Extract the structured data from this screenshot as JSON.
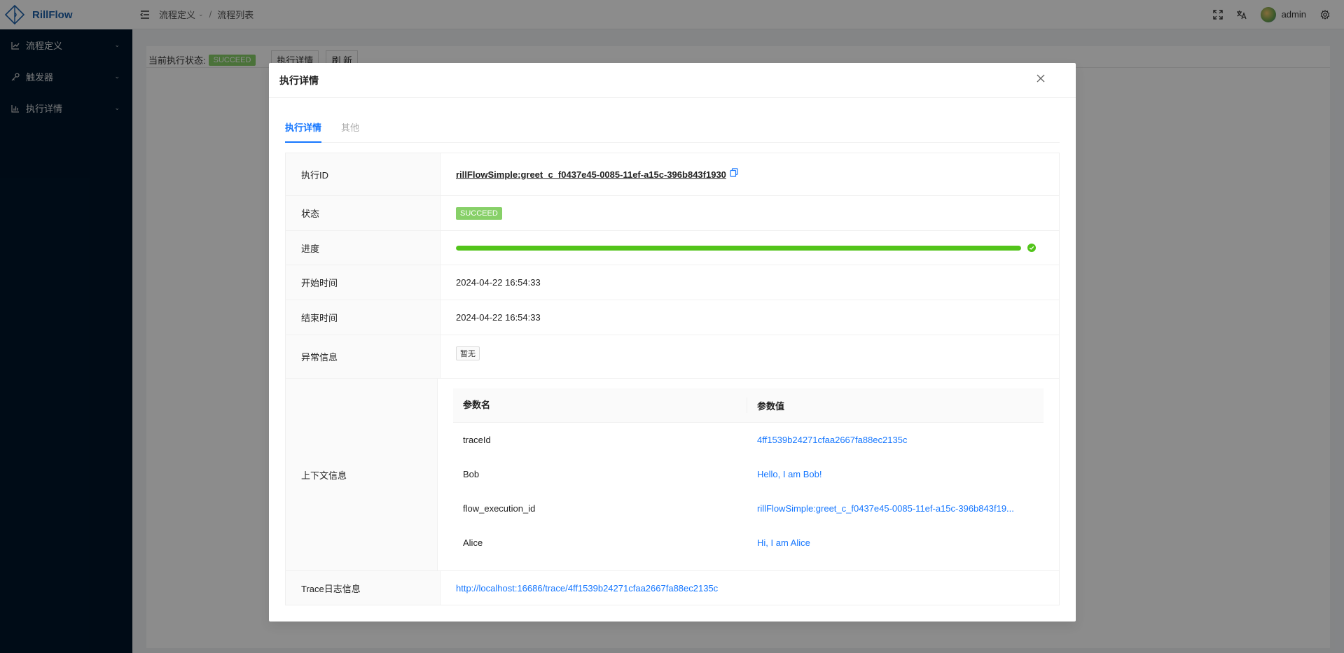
{
  "app": {
    "name": "RillFlow"
  },
  "sidebar": {
    "items": [
      {
        "label": "流程定义",
        "icon": "chart-icon"
      },
      {
        "label": "触发器",
        "icon": "key-icon"
      },
      {
        "label": "执行详情",
        "icon": "bar-chart-icon"
      }
    ]
  },
  "header": {
    "breadcrumb": [
      "流程定义",
      "流程列表"
    ],
    "user": "admin"
  },
  "page": {
    "status_label": "当前执行状态:",
    "status_value": "SUCCEED",
    "detail_button": "执行详情",
    "refresh_button": "刷 新"
  },
  "modal": {
    "title": "执行详情",
    "tabs": [
      {
        "label": "执行详情",
        "active": true
      },
      {
        "label": "其他",
        "active": false
      }
    ],
    "rows": {
      "exec_id_label": "执行ID",
      "exec_id": "rillFlowSimple:greet_c_f0437e45-0085-11ef-a15c-396b843f1930",
      "status_label": "状态",
      "status": "SUCCEED",
      "progress_label": "进度",
      "progress": 1.0,
      "start_label": "开始时间",
      "start_time": "2024-04-22 16:54:33",
      "end_label": "结束时间",
      "end_time": "2024-04-22 16:54:33",
      "error_label": "异常信息",
      "error": "暂无",
      "context_label": "上下文信息",
      "trace_label": "Trace日志信息",
      "trace_url": "http://localhost:16686/trace/4ff1539b24271cfaa2667fa88ec2135c"
    },
    "context": {
      "headers": [
        "参数名",
        "参数值"
      ],
      "rows": [
        {
          "name": "traceId",
          "value": "4ff1539b24271cfaa2667fa88ec2135c"
        },
        {
          "name": "Bob",
          "value": "Hello, I am Bob!"
        },
        {
          "name": "flow_execution_id",
          "value": "rillFlowSimple:greet_c_f0437e45-0085-11ef-a15c-396b843f19..."
        },
        {
          "name": "Alice",
          "value": "Hi, I am Alice"
        }
      ]
    }
  },
  "colors": {
    "brand": "#1c5fa8",
    "sidebar_bg": "#001529",
    "link": "#1677ff",
    "success": "#87d068",
    "progress": "#52c41a"
  }
}
